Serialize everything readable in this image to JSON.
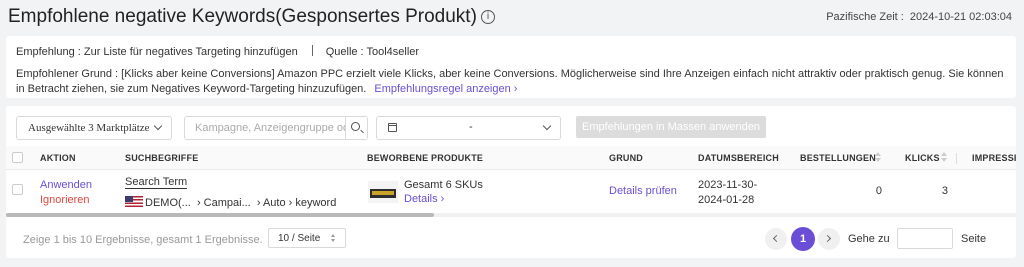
{
  "header": {
    "title": "Empfohlene negative Keywords(Gesponsertes Produkt)",
    "info_icon": "info-circle-icon",
    "timezone_label": "Pazifische Zeit :",
    "timestamp": "2024-10-21 02:03:04"
  },
  "recommendation": {
    "empfehlung": "Empfehlung : Zur Liste für negatives Targeting hinzufügen",
    "quelle": "Quelle : Tool4seller",
    "grund": "Empfohlener Grund : [Klicks aber keine Conversions] Amazon PPC erzielt viele Klicks, aber keine Conversions. Möglicherweise sind Ihre Anzeigen einfach nicht attraktiv oder praktisch genug. Sie können in Betracht ziehen, sie zum Negatives Keyword-Targeting hinzuzufügen.",
    "rule_link": "Empfehlungsregel anzeigen",
    "rule_link_icon": "chevron-right-icon"
  },
  "filters": {
    "marketplaces": "Ausgewählte 3 Marktplätze",
    "search_placeholder": "Kampagne, Anzeigengruppe oder Keyword",
    "date_separator": "-",
    "bulk_apply": "Empfehlungen in Massen anwenden"
  },
  "columns": {
    "aktion": "AKTION",
    "suchbegriffe": "SUCHBEGRIFFE",
    "produkte": "BEWORBENE PRODUKTE",
    "grund": "GRUND",
    "datum": "DATUMSBEREICH",
    "bestellungen": "BESTELLUNGEN",
    "klicks": "KLICKS",
    "impressionen": "IMPRESSI"
  },
  "rows": [
    {
      "apply": "Anwenden",
      "ignore": "Ignorieren",
      "term": "Search Term",
      "path": "DEMO(...  › Campai...  › Auto › keyword",
      "skus": "Gesamt 6 SKUs",
      "details": "Details ›",
      "reason": "Details prüfen",
      "date_from": "2023-11-30-",
      "date_to": "2024-01-28",
      "orders": "0",
      "clicks": "3"
    }
  ],
  "pagination": {
    "summary": "Zeige 1 bis 10 Ergebnisse, gesamt 1 Ergebnisse.",
    "page_size": "10 / Seite",
    "current_page": "1",
    "goto_label": "Gehe zu",
    "page_label": "Seite"
  },
  "colors": {
    "accent": "#6a4fd6",
    "ignore": "#e0463f",
    "disabled_button": "#dcdcdc"
  }
}
